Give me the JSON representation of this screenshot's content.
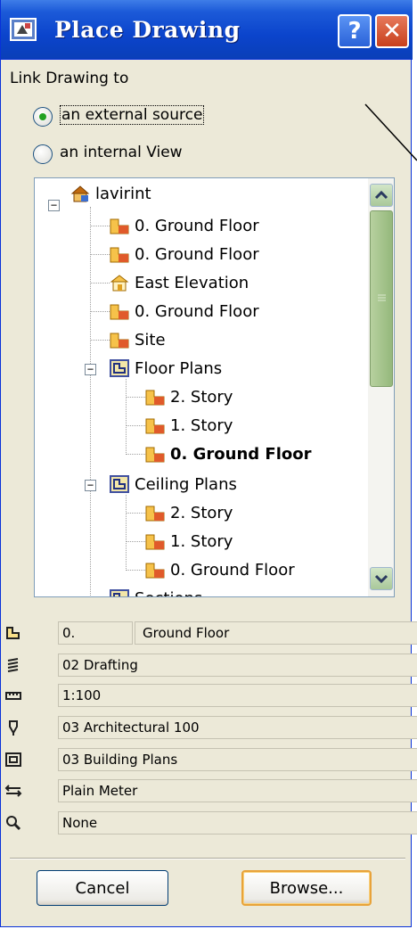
{
  "window": {
    "title": "Place Drawing",
    "help_label": "?",
    "close_label": "✕"
  },
  "link": {
    "label": "Link  Drawing to",
    "options": [
      {
        "label": "an external source",
        "selected": true
      },
      {
        "label": "an internal View",
        "selected": false
      }
    ]
  },
  "tree": {
    "root": "lavirint",
    "items": [
      {
        "label": "0. Ground Floor",
        "icon": "floor-plan-icon",
        "bold": false
      },
      {
        "label": "0. Ground Floor",
        "icon": "floor-plan-icon",
        "bold": false
      },
      {
        "label": "East Elevation",
        "icon": "elevation-icon",
        "bold": false
      },
      {
        "label": "0. Ground Floor",
        "icon": "floor-plan-icon",
        "bold": false
      },
      {
        "label": "Site",
        "icon": "floor-plan-icon",
        "bold": false
      },
      {
        "label": "Floor Plans",
        "icon": "folder-plan-icon",
        "bold": false,
        "expanded": true
      },
      {
        "label": "2. Story",
        "icon": "floor-plan-icon",
        "bold": false
      },
      {
        "label": "1. Story",
        "icon": "floor-plan-icon",
        "bold": false
      },
      {
        "label": "0. Ground Floor",
        "icon": "floor-plan-icon",
        "bold": true
      },
      {
        "label": "Ceiling Plans",
        "icon": "folder-plan-icon",
        "bold": false,
        "expanded": true
      },
      {
        "label": "2. Story",
        "icon": "floor-plan-icon",
        "bold": false
      },
      {
        "label": "1. Story",
        "icon": "floor-plan-icon",
        "bold": false
      },
      {
        "label": "0. Ground Floor",
        "icon": "floor-plan-icon",
        "bold": false
      },
      {
        "label": "Sections",
        "icon": "folder-plan-icon",
        "bold": false
      }
    ]
  },
  "properties": {
    "id": "0.",
    "name": "Ground Floor",
    "layer_combination": "02 Drafting",
    "scale": "1:100",
    "pen_set": "03 Architectural 100",
    "model_view": "03 Building Plans",
    "dimension": "Plain Meter",
    "zoom": "None"
  },
  "buttons": {
    "cancel": "Cancel",
    "browse": "Browse..."
  },
  "colors": {
    "title_bar": "#0b44cc",
    "dialog_bg": "#ece9d8",
    "default_button_border": "#e8a33a",
    "radio_dot": "#21a121"
  }
}
